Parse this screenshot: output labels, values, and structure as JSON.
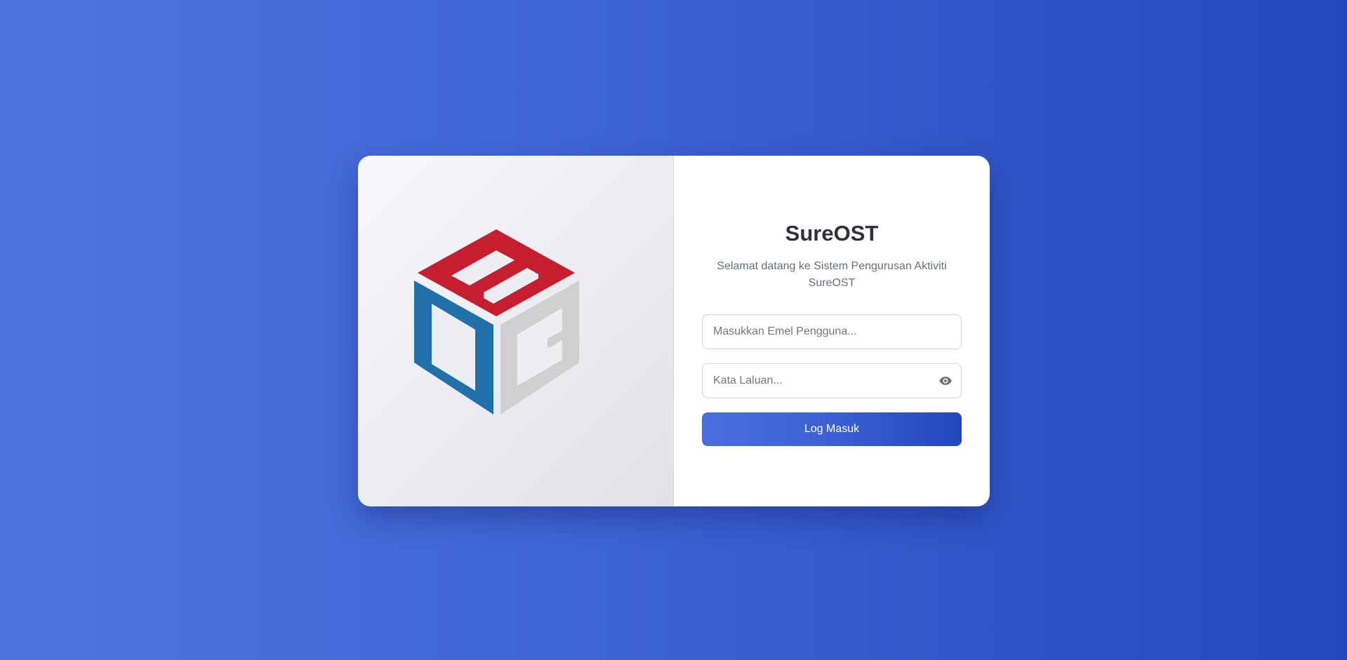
{
  "app": {
    "title": "SureOST",
    "subtitle": "Selamat datang ke Sistem Pengurusan Aktiviti SureOST"
  },
  "logo": {
    "icon": "cube-logo",
    "colors": {
      "top": "#c51f2f",
      "left": "#2170a9",
      "right": "#d0d0d0"
    }
  },
  "form": {
    "email": {
      "value": "",
      "placeholder": "Masukkan Emel Pengguna..."
    },
    "password": {
      "value": "",
      "placeholder": "Kata Laluan...",
      "toggle_icon": "eye-icon"
    },
    "submit_label": "Log Masuk"
  },
  "theme": {
    "background_start": "#4f74df",
    "background_end": "#2447bd",
    "button_start": "#4a6fdd",
    "button_end": "#2446bd"
  }
}
